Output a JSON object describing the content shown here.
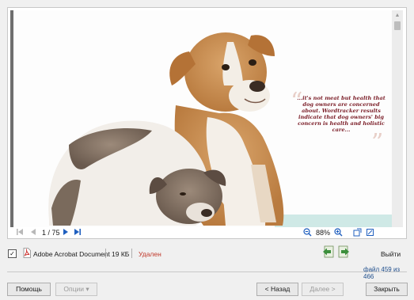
{
  "viewer": {
    "quote_text": "...it's not meat but health that dog owners are concerned about. Wordtracker results indicate that dog owners' big concern is health and holistic care...",
    "open_quote": "“",
    "close_quote": "”",
    "page_indicator": "1 / 75",
    "zoom": "88%",
    "icons": {
      "first_page": "first-page-icon",
      "prev_page": "previous-page-icon",
      "next_page": "next-page-icon",
      "last_page": "last-page-icon",
      "zoom_out": "zoom-out-icon",
      "zoom_in": "zoom-in-icon",
      "rotate": "rotate-icon",
      "fit": "fit-page-icon"
    }
  },
  "file_info": {
    "checked": "✓",
    "type": "Adobe Acrobat Document",
    "size": "19 КБ",
    "status": "Удален",
    "status_color": "#c0392b",
    "exit_label": "Выйти",
    "counter": "файл 459 из 466",
    "counter_color": "#1f4e8c"
  },
  "buttons": {
    "help": "Помощь",
    "options": "Опции ▾",
    "back": "< Назад",
    "next": "Далее >",
    "close": "Закрыть"
  },
  "colors": {
    "accent_blue": "#1f5fbf",
    "nav_green": "#3c8f3c"
  }
}
